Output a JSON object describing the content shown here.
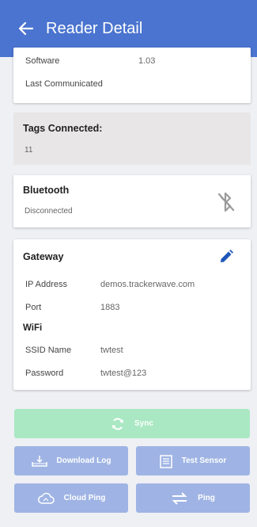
{
  "header": {
    "title": "Reader Detail"
  },
  "info": {
    "software_label": "Software",
    "software_value": "1.03",
    "last_label": "Last Communicated"
  },
  "tags": {
    "title": "Tags Connected:",
    "value": "11"
  },
  "bluetooth": {
    "title": "Bluetooth",
    "status": "Disconnected",
    "icon": "bluetooth-disabled-icon"
  },
  "gateway": {
    "title": "Gateway",
    "ip_label": "IP Address",
    "ip_value": "demos.trackerwave.com",
    "port_label": "Port",
    "port_value": "1883",
    "wifi_title": "WiFi",
    "ssid_label": "SSID Name",
    "ssid_value": "twtest",
    "password_label": "Password",
    "password_value": "twtest@123",
    "edit_icon": "pencil-icon"
  },
  "actions": {
    "sync": "Sync",
    "download_log": "Download Log",
    "test_sensor": "Test Sensor",
    "cloud_ping": "Cloud Ping",
    "ping": "Ping"
  },
  "colors": {
    "appbar": "#4a74cf",
    "sync_button": "#a9e8c3",
    "action_button": "#9fb4e4",
    "edit_icon": "#1e57b8"
  }
}
